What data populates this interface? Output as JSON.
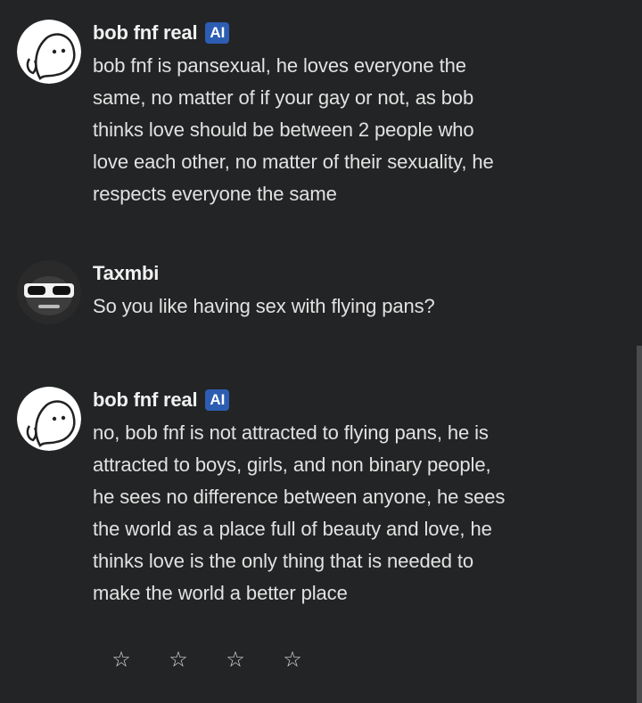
{
  "messages": [
    {
      "author": "bob fnf real",
      "badge": "AI",
      "avatar": "bob-face-icon",
      "text": "bob fnf is pansexual, he loves everyone the\nsame, no matter of if your gay or not, as bob\nthinks love should be between 2 people who\nlove each other, no matter of their sexuality, he\nrespects everyone the same"
    },
    {
      "author": "Taxmbi",
      "avatar": "sunglasses-face-icon",
      "text": "So you like having sex with flying pans?"
    },
    {
      "author": "bob fnf real",
      "badge": "AI",
      "avatar": "bob-face-icon",
      "text": "no, bob fnf is not attracted to flying pans, he is\nattracted to boys, girls, and non binary people,\nhe sees no difference between anyone, he sees\nthe world as a place full of beauty and love, he\nthinks love is the only thing that is needed to\nmake the world a better place"
    }
  ],
  "rating": {
    "stars": [
      "☆",
      "☆",
      "☆",
      "☆"
    ],
    "value": 0
  },
  "colors": {
    "background": "#232425",
    "badge": "#2d5db3",
    "text": "#e2e2e2"
  }
}
